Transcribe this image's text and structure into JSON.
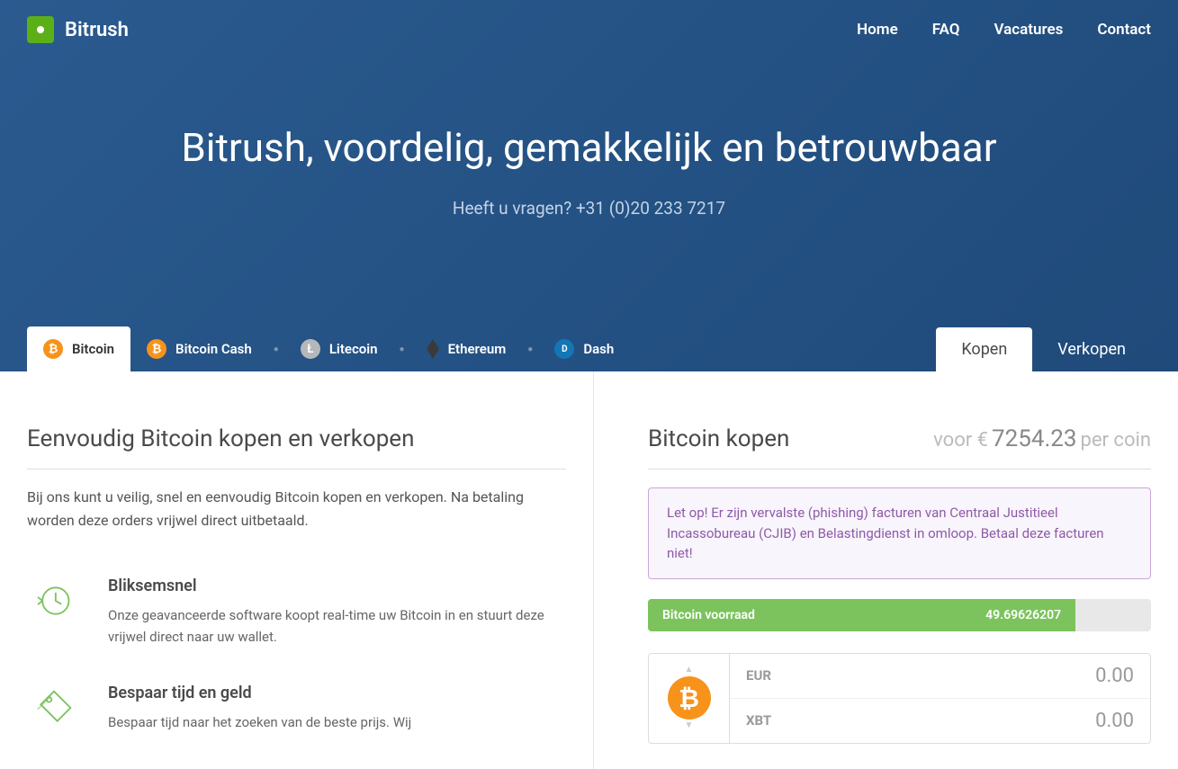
{
  "brand": "Bitrush",
  "nav": {
    "home": "Home",
    "faq": "FAQ",
    "vacatures": "Vacatures",
    "contact": "Contact"
  },
  "hero": {
    "title": "Bitrush, voordelig, gemakkelijk en betrouwbaar",
    "subtitle": "Heeft u vragen? +31 (0)20 233 7217"
  },
  "crypto_tabs": {
    "bitcoin": "Bitcoin",
    "bitcoin_cash": "Bitcoin Cash",
    "litecoin": "Litecoin",
    "ethereum": "Ethereum",
    "dash": "Dash"
  },
  "action_tabs": {
    "kopen": "Kopen",
    "verkopen": "Verkopen"
  },
  "left": {
    "title": "Eenvoudig Bitcoin kopen en verkopen",
    "intro": "Bij ons kunt u veilig, snel en eenvoudig Bitcoin kopen en verkopen. Na betaling worden deze orders vrijwel direct uitbetaald.",
    "feature1": {
      "title": "Bliksemsnel",
      "text": "Onze geavanceerde software koopt real-time uw Bitcoin in en stuurt deze vrijwel direct naar uw wallet."
    },
    "feature2": {
      "title": "Bespaar tijd en geld",
      "text": "Bespaar tijd naar het zoeken van de beste prijs. Wij"
    }
  },
  "right": {
    "buy_title": "Bitcoin kopen",
    "price_prefix": "voor €",
    "price_value": "7254.23",
    "price_suffix": "per coin",
    "warning": "Let op! Er zijn vervalste (phishing) facturen van Centraal Justitieel Incassobureau (CJIB) en Belastingdienst in omloop. Betaal deze facturen niet!",
    "stock_label": "Bitcoin voorraad",
    "stock_value": "49.69626207",
    "calc": {
      "eur_label": "EUR",
      "eur_value": "0.00",
      "xbt_label": "XBT",
      "xbt_value": "0.00"
    }
  }
}
